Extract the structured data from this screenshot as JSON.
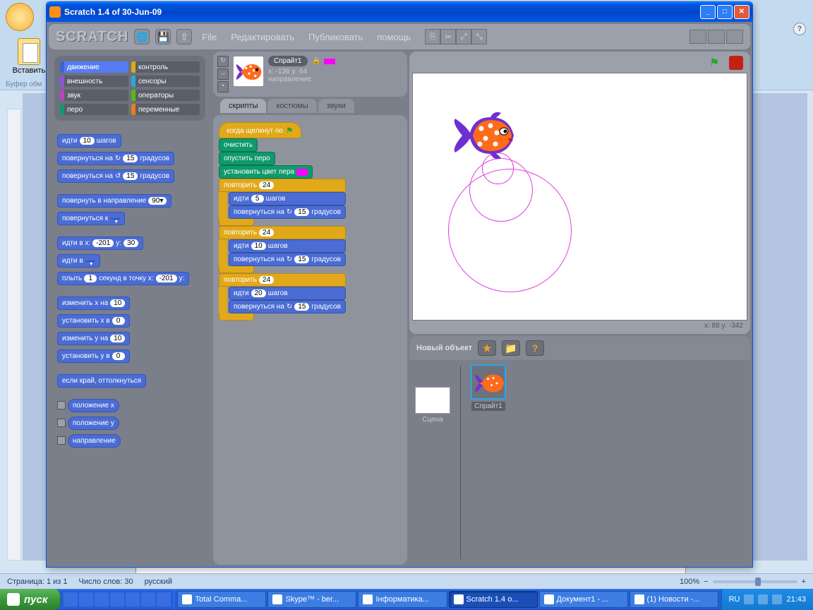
{
  "window": {
    "title": "Scratch 1.4 of 30-Jun-09"
  },
  "toolbar": {
    "logo": "SCRATCH"
  },
  "menu": [
    "File",
    "Редактировать",
    "Публиковать",
    "помощь"
  ],
  "categories": {
    "left": [
      {
        "key": "motion",
        "label": "движение",
        "active": true
      },
      {
        "key": "looks",
        "label": "внешность"
      },
      {
        "key": "sound",
        "label": "звук"
      },
      {
        "key": "pen",
        "label": "перо"
      }
    ],
    "right": [
      {
        "key": "control",
        "label": "контроль"
      },
      {
        "key": "sensing",
        "label": "сенсоры"
      },
      {
        "key": "operators",
        "label": "операторы"
      },
      {
        "key": "variables",
        "label": "переменные"
      }
    ]
  },
  "palette": {
    "move": {
      "pre": "идти",
      "val": "10",
      "post": "шагов"
    },
    "turnCW": {
      "pre": "повернуться на",
      "val": "15",
      "post": "градусов"
    },
    "turnCCW": {
      "pre": "повернуться на",
      "val": "15",
      "post": "градусов"
    },
    "point": {
      "pre": "повернуть в направление",
      "val": "90▾"
    },
    "pointTowards": {
      "pre": "повернуться к",
      "val": " "
    },
    "goto": {
      "pre": "идти в x:",
      "x": "-201",
      "mid": "y:",
      "y": "30"
    },
    "gotoSprite": {
      "pre": "идти в",
      "val": " "
    },
    "glide": {
      "pre": "плыть",
      "sec": "1",
      "mid": "секунд в точку x:",
      "x": "-201",
      "mid2": "y:",
      "y": " "
    },
    "changeX": {
      "pre": "изменить x на",
      "val": "10"
    },
    "setX": {
      "pre": "установить x в",
      "val": "0"
    },
    "changeY": {
      "pre": "изменить y на",
      "val": "10"
    },
    "setY": {
      "pre": "установить y в",
      "val": "0"
    },
    "bounce": "если край, оттолкнуться",
    "xpos": "положение x",
    "ypos": "положение y",
    "direction": "направление"
  },
  "sprite": {
    "name": "Спрайт1",
    "coords": "x: -136 y: 64",
    "direction": "направление:"
  },
  "tabs": [
    "скрипты",
    "костюмы",
    "звуки"
  ],
  "script": {
    "hat": "когда щелкнут по",
    "clear": "очистить",
    "pendown": "опустить перо",
    "setcolor": "установить цвет пера",
    "repeat": "повторить",
    "r1": "24",
    "r1_move": "5",
    "r1_turn": "15",
    "r2": "24",
    "r2_move": "10",
    "r2_turn": "15",
    "r3": "24",
    "r3_move": "20",
    "r3_turn": "15",
    "move_pre": "идти",
    "move_post": "шагов",
    "turn_pre": "повернуться на",
    "turn_post": "градусов"
  },
  "stage": {
    "mouse": "x: 88      y: -342",
    "new_object": "Новый объект",
    "scene": "Сцена",
    "sprite1": "Спрайт1"
  },
  "word": {
    "paste": "Вставить",
    "buffer": "Буфер обм",
    "status_page": "Страница: 1 из 1",
    "status_words": "Число слов: 30",
    "status_lang": "русский",
    "zoom": "100%"
  },
  "taskbar": {
    "start": "пуск",
    "items": [
      "Total Comma...",
      "Skype™ - ber...",
      "Інформатика...",
      "Scratch 1.4 o...",
      "Документ1 - ...",
      "(1) Новости -..."
    ],
    "lang": "RU",
    "time": "21:43"
  }
}
